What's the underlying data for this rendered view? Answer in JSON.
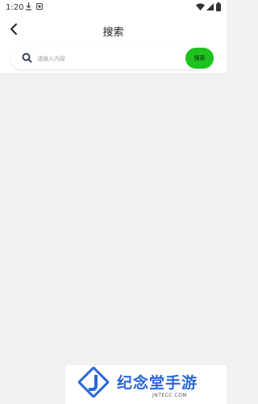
{
  "status_bar": {
    "time": "1:20"
  },
  "header": {
    "title": "搜索"
  },
  "search": {
    "placeholder": "请输入内容",
    "button_label": "搜索"
  },
  "watermark": {
    "name": "纪念堂手游",
    "domain": "JNTECC.COM"
  },
  "colors": {
    "accent": "#1ec21e",
    "background": "#f1f1f1",
    "brand": "#2b66d8"
  },
  "icons": [
    "download-icon",
    "notification-square-icon",
    "wifi-icon",
    "signal-icon",
    "battery-icon",
    "back-arrow-icon",
    "search-icon",
    "logo-icon"
  ]
}
